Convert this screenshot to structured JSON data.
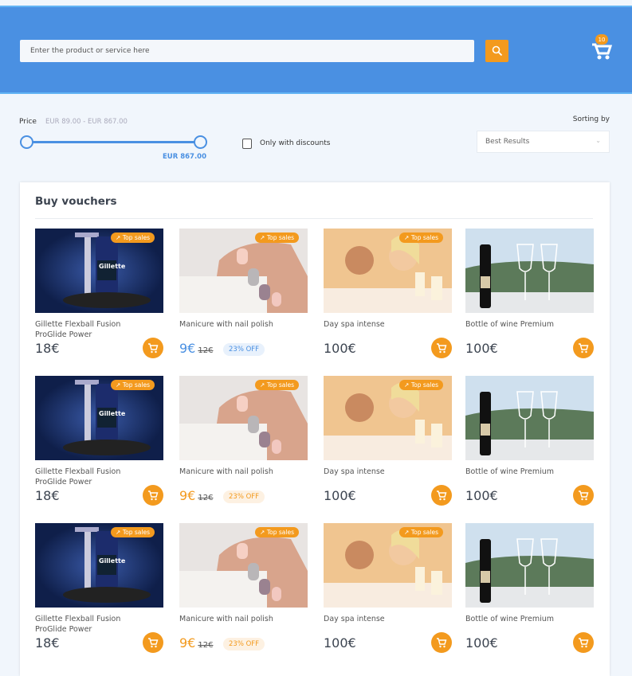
{
  "header": {
    "search_placeholder": "Enter the product or service here",
    "cart_count": "10"
  },
  "filters": {
    "price_label": "Price",
    "price_range": "EUR 89.00 - EUR 867.00",
    "price_max_value": "EUR 867.00",
    "discount_label": "Only with discounts",
    "discount_checked": false,
    "sort_label": "Sorting by",
    "sort_value": "Best Results"
  },
  "panel": {
    "title": "Buy vouchers"
  },
  "colors": {
    "primary": "#4a90e2",
    "accent": "#f39a1e"
  },
  "rows": [
    {
      "products": [
        {
          "name": "Gillette Flexball Fusion ProGlide Power",
          "price": "18€",
          "top_sales": "Top sales",
          "image": "gillette"
        },
        {
          "name": "Manicure with nail polish",
          "price": "9€",
          "old_price": "12€",
          "discount": "23% OFF",
          "top_sales": "Top sales",
          "image": "nails",
          "highlight": "blue"
        },
        {
          "name": "Day spa intense",
          "price": "100€",
          "top_sales": "Top sales",
          "image": "spa"
        },
        {
          "name": "Bottle of wine Premium",
          "price": "100€",
          "image": "wine"
        }
      ]
    },
    {
      "products": [
        {
          "name": "Gillette Flexball Fusion ProGlide Power",
          "price": "18€",
          "top_sales": "Top sales",
          "image": "gillette"
        },
        {
          "name": "Manicure with nail polish",
          "price": "9€",
          "old_price": "12€",
          "discount": "23% OFF",
          "top_sales": "Top sales",
          "image": "nails"
        },
        {
          "name": "Day spa intense",
          "price": "100€",
          "top_sales": "Top sales",
          "image": "spa"
        },
        {
          "name": "Bottle of wine Premium",
          "price": "100€",
          "image": "wine"
        }
      ]
    },
    {
      "products": [
        {
          "name": "Gillette Flexball Fusion ProGlide Power",
          "price": "18€",
          "top_sales": "Top sales",
          "image": "gillette"
        },
        {
          "name": "Manicure with nail polish",
          "price": "9€",
          "old_price": "12€",
          "discount": "23% OFF",
          "top_sales": "Top sales",
          "image": "nails"
        },
        {
          "name": "Day spa intense",
          "price": "100€",
          "top_sales": "Top sales",
          "image": "spa"
        },
        {
          "name": "Bottle of wine Premium",
          "price": "100€",
          "image": "wine"
        }
      ]
    }
  ]
}
